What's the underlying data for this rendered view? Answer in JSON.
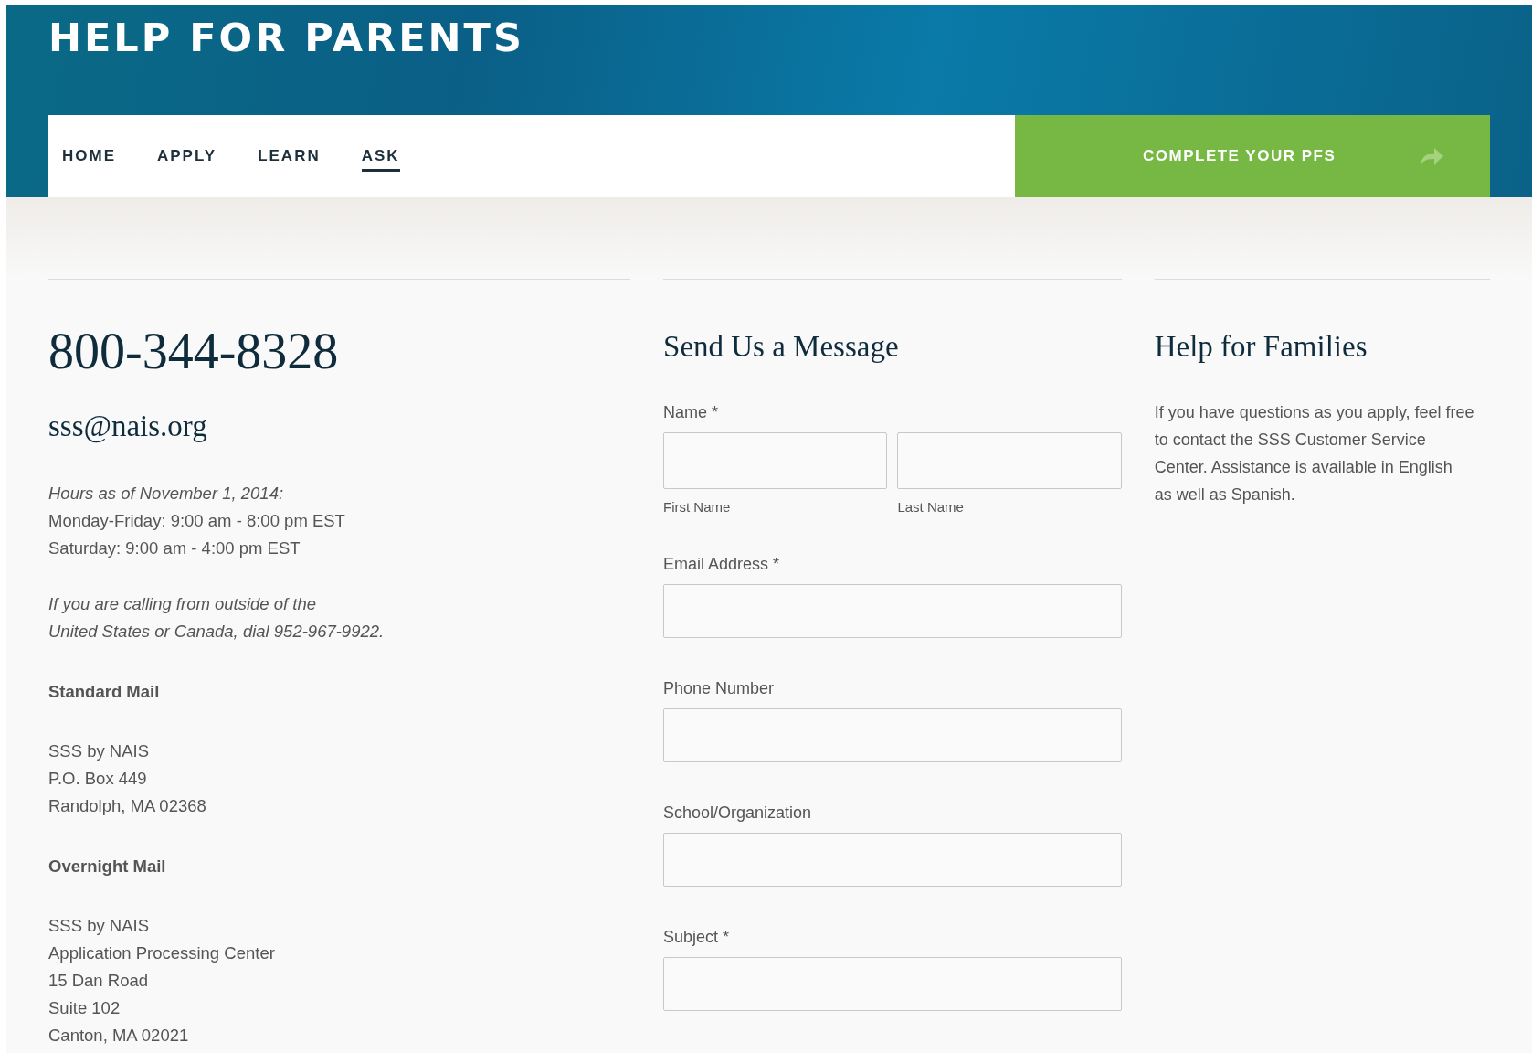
{
  "header": {
    "title": "HELP FOR PARENTS"
  },
  "nav": {
    "items": [
      {
        "label": "HOME",
        "selected": false
      },
      {
        "label": "APPLY",
        "selected": false
      },
      {
        "label": "LEARN",
        "selected": false
      },
      {
        "label": "ASK",
        "selected": true
      }
    ],
    "cta": {
      "label": "COMPLETE YOUR PFS"
    }
  },
  "contact": {
    "phone": "800-344-8328",
    "email": "sss@nais.org",
    "hours": [
      {
        "kind": "note",
        "text": "Hours as of  November 1, 2014:"
      },
      {
        "kind": "plain",
        "text": "Monday-Friday: 9:00 am - 8:00 pm EST"
      },
      {
        "kind": "plain",
        "text": "Saturday:  9:00 am - 4:00 pm EST"
      }
    ],
    "international": "If you are calling from outside of the\nUnited States or Canada, dial 952-967-9922.",
    "mail": [
      {
        "heading": "Standard Mail",
        "address": "SSS by NAIS\nP.O. Box 449\nRandolph, MA 02368"
      },
      {
        "heading": "Overnight Mail",
        "address": "SSS by NAIS\nApplication Processing Center\n15 Dan Road\nSuite 102\nCanton, MA 02021"
      }
    ]
  },
  "form": {
    "title": "Send Us a Message",
    "fields": [
      {
        "kind": "split",
        "label": "Name *",
        "parts": [
          "First Name",
          "Last Name"
        ]
      },
      {
        "kind": "text",
        "label": "Email Address *"
      },
      {
        "kind": "text",
        "label": "Phone Number"
      },
      {
        "kind": "text",
        "label": "School/Organization"
      },
      {
        "kind": "text",
        "label": "Subject *"
      }
    ]
  },
  "help": {
    "title": "Help for Families",
    "text": "If you have questions as you apply, feel free to contact the SSS Customer Service Center. Assistance is available in English as well as Spanish."
  }
}
